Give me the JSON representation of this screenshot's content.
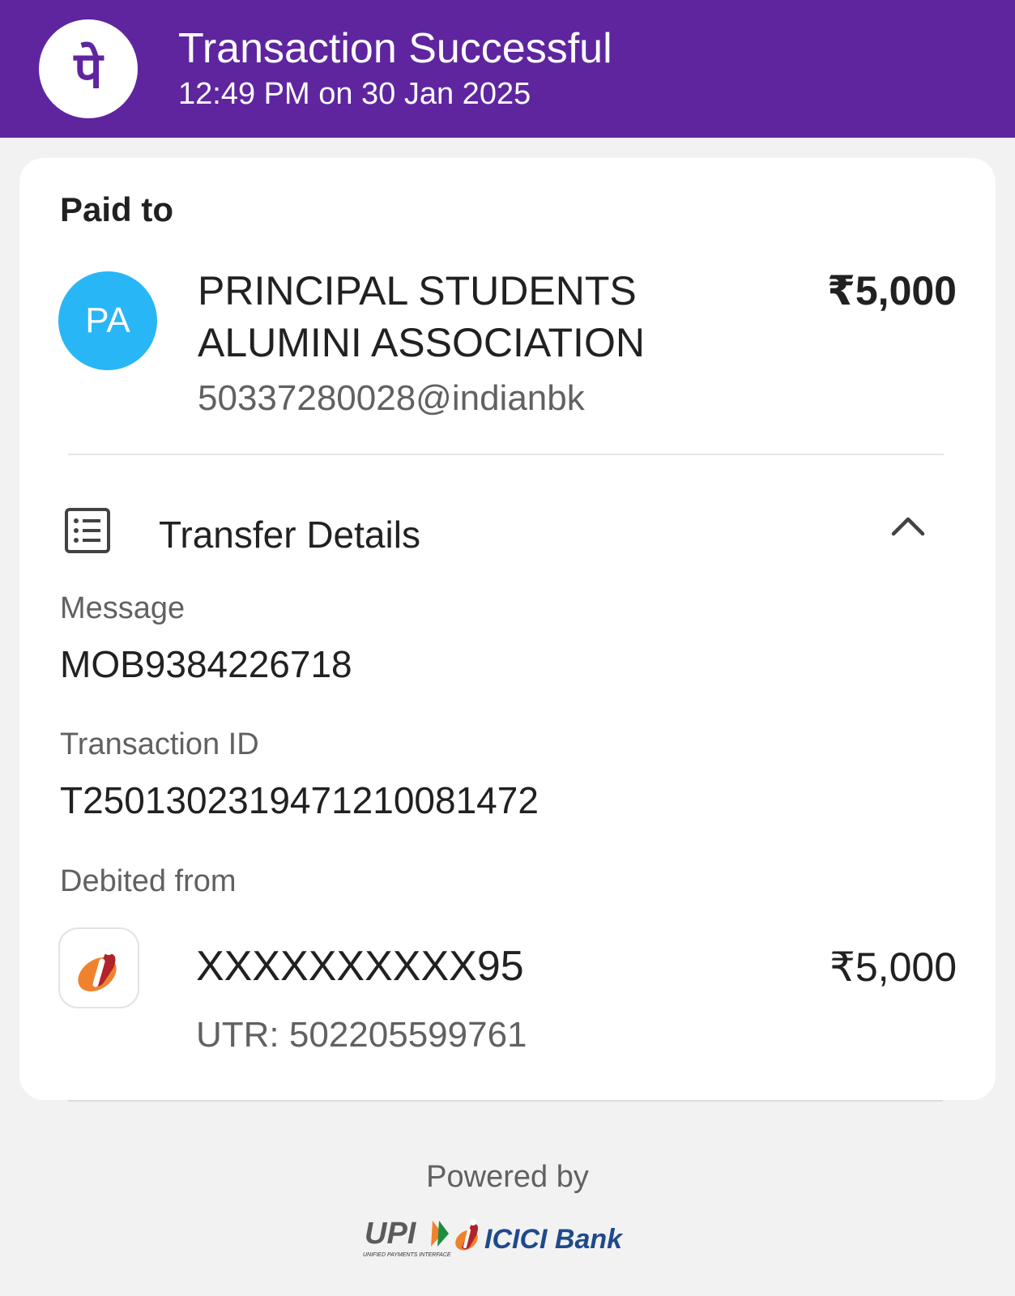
{
  "header": {
    "title": "Transaction Successful",
    "datetime": "12:49 PM on 30 Jan 2025",
    "logo_glyph": "पे",
    "logo_icon": "phonepe-logo-icon",
    "background_color": "#5f259f"
  },
  "payee": {
    "section_label": "Paid to",
    "avatar_initials": "PA",
    "avatar_color": "#29b6f6",
    "name": "PRINCIPAL STUDENTS ALUMINI ASSOCIATION",
    "upi_id": "50337280028@indianbk",
    "amount": "₹5,000"
  },
  "transfer_details": {
    "title": "Transfer Details",
    "icon": "list-details-icon",
    "toggle_icon": "chevron-up-icon",
    "message_label": "Message",
    "message_value": "MOB9384226718",
    "transaction_id_label": "Transaction ID",
    "transaction_id_value": "T2501302319471210081472",
    "debited_from_label": "Debited from",
    "account_number": "XXXXXXXXXX95",
    "utr": "UTR: 502205599761",
    "debit_amount": "₹5,000",
    "bank_icon": "icici-bank-logo-icon"
  },
  "footer": {
    "powered_by": "Powered by",
    "upi_logo_text": "UPI",
    "upi_tagline": "UNIFIED PAYMENTS INTERFACE",
    "bank_name": "ICICI Bank"
  }
}
